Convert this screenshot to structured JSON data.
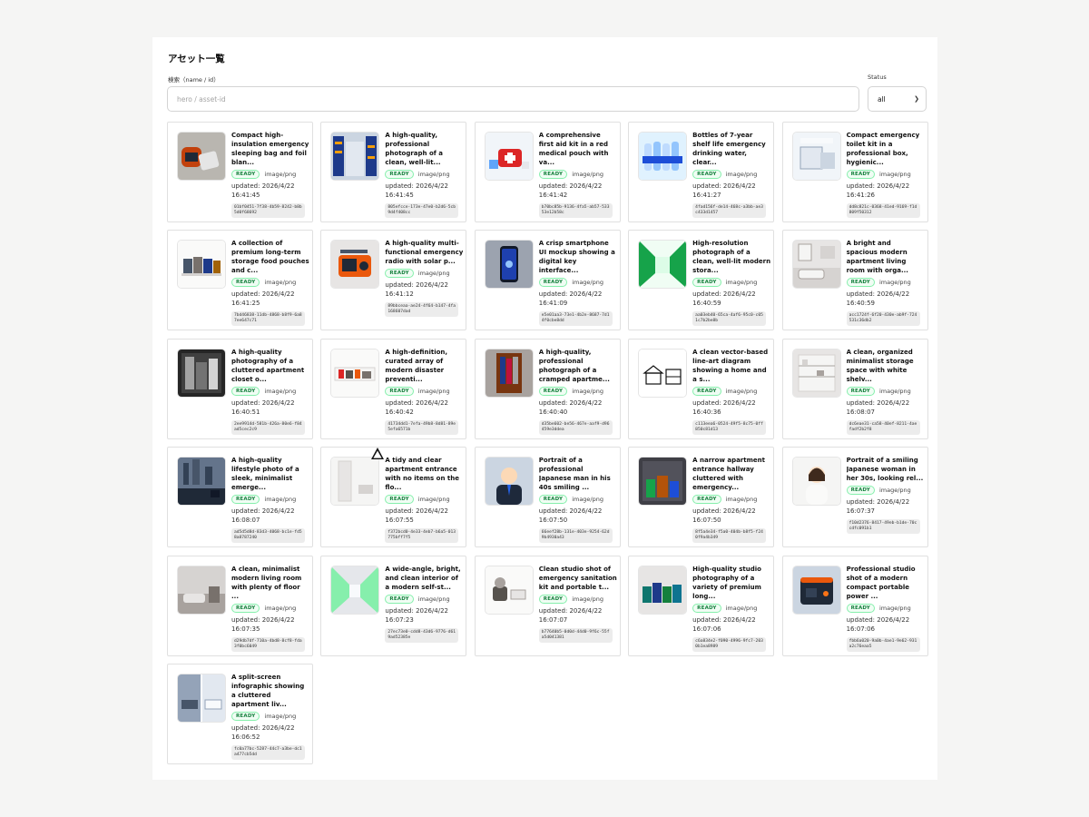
{
  "header": {
    "title": "アセット一覧"
  },
  "search": {
    "label": "検索（name / id）",
    "placeholder": "hero / asset-id",
    "value": ""
  },
  "status_filter": {
    "label": "Status",
    "selected": "all"
  },
  "colors": {
    "ready_text": "#15803d",
    "ready_border": "#86efac",
    "ready_bg": "#f0fdf4"
  },
  "assets": [
    {
      "title": "Compact high-insulation emergency sleeping bag and foil blan...",
      "status": "READY",
      "mime": "image/png",
      "updated": "updated: 2026/4/22 16:41:45",
      "id": "01bf0451-7f38-4b59-8242-b8b5d0f68692",
      "thumb": "sleeping-bag"
    },
    {
      "title": "A high-quality, professional photograph of a clean, well-lit...",
      "status": "READY",
      "mime": "image/png",
      "updated": "updated: 2026/4/22 16:41:45",
      "id": "805efcce-173e-47e0-b2d6-5cb9d4f408cc",
      "thumb": "storage-room"
    },
    {
      "title": "A comprehensive first aid kit in a red medical pouch with va...",
      "status": "READY",
      "mime": "image/png",
      "updated": "updated: 2026/4/22 16:41:42",
      "id": "b70bc85b-9136-4fa5-ab57-53353e12b58c",
      "thumb": "first-aid-kit"
    },
    {
      "title": "Bottles of 7-year shelf life emergency drinking water, clear...",
      "status": "READY",
      "mime": "image/png",
      "updated": "updated: 2026/4/22 16:41:27",
      "id": "4fad156f-de14-468c-a3bb-ae3c433d1457",
      "thumb": "water-bottles"
    },
    {
      "title": "Compact emergency toilet kit in a professional box, hygienic...",
      "status": "READY",
      "mime": "image/png",
      "updated": "updated: 2026/4/22 16:41:26",
      "id": "dd8c821c-0368-41ed-9169-f1d809f50312",
      "thumb": "toilet-kit"
    },
    {
      "title": "A collection of premium long-term storage food pouches and c...",
      "status": "READY",
      "mime": "image/png",
      "updated": "updated: 2026/4/22 16:41:25",
      "id": "7bd46838-11db-4868-b8f9-6a87ee647c71",
      "thumb": "food-pouches"
    },
    {
      "title": "A high-quality multi-functional emergency radio with solar p...",
      "status": "READY",
      "mime": "image/png",
      "updated": "updated: 2026/4/22 16:41:12",
      "id": "89bbceaa-ae24-4f64-b147-4fa168607dad",
      "thumb": "radio"
    },
    {
      "title": "A crisp smartphone UI mockup showing a digital key interface...",
      "status": "READY",
      "mime": "image/png",
      "updated": "updated: 2026/4/22 16:41:09",
      "id": "e5e01aa3-73e1-4b2e-8687-7d14f0cbe8dd",
      "thumb": "smartphone"
    },
    {
      "title": "High-resolution photograph of a clean, well-lit modern stora...",
      "status": "READY",
      "mime": "image/png",
      "updated": "updated: 2026/4/22 16:40:59",
      "id": "aa03eb40-65ca-4af6-95c0-c051c7b2be8b",
      "thumb": "green-corridor"
    },
    {
      "title": "A bright and spacious modern apartment living room with orga...",
      "status": "READY",
      "mime": "image/png",
      "updated": "updated: 2026/4/22 16:40:59",
      "id": "acc1724f-6f20-430e-ab9f-724531c36db2",
      "thumb": "living-room"
    },
    {
      "title": "A high-quality photography of a cluttered apartment closet o...",
      "status": "READY",
      "mime": "image/png",
      "updated": "updated: 2026/4/22 16:40:51",
      "id": "2ee9914d-581b-426a-80e6-f84ad5cec2c9",
      "thumb": "cluttered-closet"
    },
    {
      "title": "A high-definition, curated array of modern disaster preventi...",
      "status": "READY",
      "mime": "image/png",
      "updated": "updated: 2026/4/22 16:40:42",
      "id": "41734dd1-7efa-49b8-8d81-89e5efa6571b",
      "thumb": "disaster-shelf"
    },
    {
      "title": "A high-quality, professional photograph of a cramped apartme...",
      "status": "READY",
      "mime": "image/png",
      "updated": "updated: 2026/4/22 16:40:40",
      "id": "d35be602-be56-467e-aaf9-d96459e3ddea",
      "thumb": "cramped-closet"
    },
    {
      "title": "A clean vector-based line-art diagram showing a home and a s...",
      "status": "READY",
      "mime": "image/png",
      "updated": "updated: 2026/4/22 16:40:36",
      "id": "c113eea6-0524-49f5-8c75-0ff850c81d13",
      "thumb": "line-art"
    },
    {
      "title": "A clean, organized minimalist storage space with white shelv...",
      "status": "READY",
      "mime": "image/png",
      "updated": "updated: 2026/4/22 16:08:07",
      "id": "dc6eae31-ca58-40ef-8211-4aefadf2b2f8",
      "thumb": "white-shelves"
    },
    {
      "title": "A high-quality lifestyle photo of a sleek, minimalist emerge...",
      "status": "READY",
      "mime": "image/png",
      "updated": "updated: 2026/4/22 16:08:07",
      "id": "ad5d5d8d-83d3-4068-bc1e-fd58a8787240",
      "thumb": "city-window"
    },
    {
      "title": "A tidy and clear apartment entrance with no items on the flo...",
      "status": "READY",
      "mime": "image/png",
      "updated": "updated: 2026/4/22 16:07:55",
      "id": "f372bcd0-4e33-4eb7-b6a5-013775bff7f5",
      "thumb": "tidy-entrance"
    },
    {
      "title": "Portrait of a professional Japanese man in his 40s smiling ...",
      "status": "READY",
      "mime": "image/png",
      "updated": "updated: 2026/4/22 16:07:50",
      "id": "66eef28b-131e-403e-9254-62d9b4930a43",
      "thumb": "man-portrait"
    },
    {
      "title": "A narrow apartment entrance hallway cluttered with emergency...",
      "status": "READY",
      "mime": "image/png",
      "updated": "updated: 2026/4/22 16:07:50",
      "id": "8f5a4e34-f5a0-404b-b8f5-f240f9a4b349",
      "thumb": "cluttered-hallway"
    },
    {
      "title": "Portrait of a smiling Japanese woman in her 30s, looking rel...",
      "status": "READY",
      "mime": "image/png",
      "updated": "updated: 2026/4/22 16:07:37",
      "id": "f10d2376-8417-49eb-b1de-70ccdfc091b1",
      "thumb": "woman-portrait"
    },
    {
      "title": "A clean, minimalist modern living room with plenty of floor ...",
      "status": "READY",
      "mime": "image/png",
      "updated": "updated: 2026/4/22 16:07:35",
      "id": "d29db7df-710a-4bd8-8cf8-fda3f0bc6049",
      "thumb": "minimal-living"
    },
    {
      "title": "A wide-angle, bright, and clean interior of a modern self-st...",
      "status": "READY",
      "mime": "image/png",
      "updated": "updated: 2026/4/22 16:07:23",
      "id": "27ec73e0-cdd8-43d6-9776-d619ad52385e",
      "thumb": "self-storage"
    },
    {
      "title": "Clean studio shot of emergency sanitation kit and portable t...",
      "status": "READY",
      "mime": "image/png",
      "updated": "updated: 2026/4/22 16:07:07",
      "id": "b77640b5-0d0d-44d0-9f6c-55fa5d041381",
      "thumb": "sanitation-kit"
    },
    {
      "title": "High-quality studio photography of a variety of premium long...",
      "status": "READY",
      "mime": "image/png",
      "updated": "updated: 2026/4/22 16:07:06",
      "id": "c6a834e2-f090-4996-9fc7-2030b1ea8989",
      "thumb": "food-cans"
    },
    {
      "title": "Professional studio shot of a modern compact portable power ...",
      "status": "READY",
      "mime": "image/png",
      "updated": "updated: 2026/4/22 16:07:06",
      "id": "fbb6a020-9a0b-4ae1-9e62-931a2c76eaa5",
      "thumb": "power-station"
    },
    {
      "title": "A split-screen infographic showing a cluttered apartment liv...",
      "status": "READY",
      "mime": "image/png",
      "updated": "updated: 2026/4/22 16:06:52",
      "id": "fc0a77bc-5287-44c7-a3be-dc1a477cb5dd",
      "thumb": "infographic"
    }
  ]
}
